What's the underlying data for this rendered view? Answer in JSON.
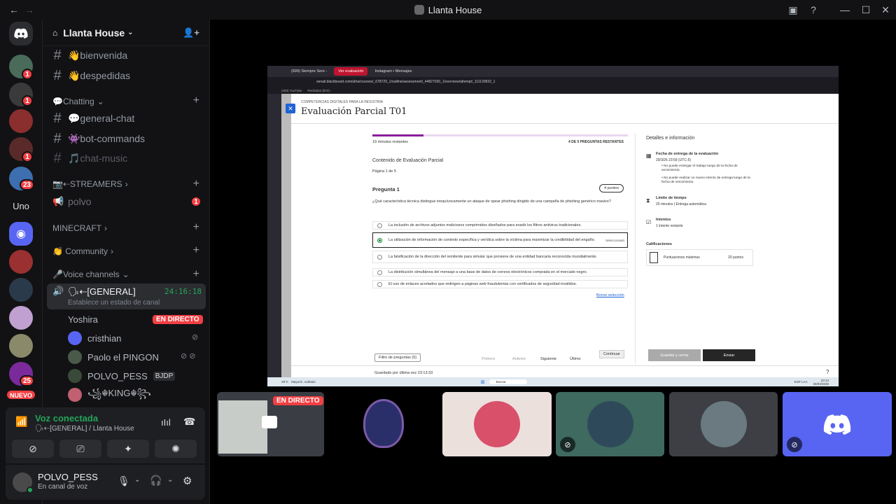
{
  "window": {
    "title": "Llanta House"
  },
  "colors": {
    "accent": "#5865f2",
    "danger": "#f23f43",
    "connected": "#23a55a",
    "bg": "#121214"
  },
  "rail": {
    "badges": [
      "1",
      "1",
      "1",
      "1",
      "23",
      "25"
    ],
    "text_guild": "Uno",
    "new_badge": "NUEVO"
  },
  "server": {
    "name": "Llanta House"
  },
  "channels": {
    "bienvenida": "👋bienvenida",
    "despedidas": "👋despedidas",
    "cat_chatting": "💬Chatting",
    "general_chat": "💬general-chat",
    "bot_commands": "👾bot-commands",
    "chat_music": "🎵chat-music",
    "cat_streamers": "📷⇠STREAMERS",
    "polvo": "polvo",
    "polvo_badge": "1",
    "cat_minecraft": "MINECRAFT",
    "cat_community": "👏 Community",
    "cat_voice": "🎤Voice channels",
    "voice_general": "🗣⇠[GENERAL]",
    "voice_timer": "24:16:18",
    "voice_status": "Establece un estado de canal"
  },
  "voice_users": [
    {
      "name": "Yoshira",
      "live": "EN DIRECTO"
    },
    {
      "name": "cristhian"
    },
    {
      "name": "Paolo el PINGON"
    },
    {
      "name": "POLVO_PESS",
      "tag": "BJDP"
    },
    {
      "name": "꧁☬KING☬꧂"
    }
  ],
  "voicepanel": {
    "status": "Voz conectada",
    "channel": "🗣⇠[GENERAL] / Llanta House"
  },
  "user": {
    "name": "POLVO_PESS",
    "status": "En canal de voz"
  },
  "tiles": {
    "live": "EN DIRECTO"
  },
  "shared": {
    "tabs": [
      "(699) Siempre Sere -",
      "Ver evaluación",
      "Instagram • Mensajes"
    ],
    "url": "senati.blackboard.com/ultra/courses/_678729_1/outline/assessment/_44827030_1/overview/attempt/_111120832_1",
    "bookmarks": [
      "(403) YouTube",
      "Recibidos (872) -"
    ],
    "course": "COMPETENCIAS DIGITALES PARA LA INDUSTRIA",
    "exam_title": "Evaluación Parcial T01",
    "time_left": "19 minutos restantes",
    "progress": "4 DE 5 PREGUNTAS RESTANTES",
    "progress_fraction": 0.2,
    "content_title": "Contenido de Evaluación Parcial",
    "page": "Página 1 de 5",
    "question_title": "Pregunta 1",
    "points": "4 puntos",
    "question": "¿Qué característica técnica distingue inequívocamente un ataque de spear phishing dirigido de una campaña de phishing genérico masivo?",
    "options": [
      "La inclusión de archivos adjuntos maliciosos comprimidos diseñados para evadir los filtros antivirus tradicionales.",
      "La utilización de información de contexto específica y verídica sobre la víctima para maximizar la credibilidad del engaño.",
      "La falsificación de la dirección del remitente para simular que proviene de una entidad bancaria reconocida mundialmente.",
      "La distribución simultánea del mensaje a una base de datos de correos electrónicos comprada en el mercado negro.",
      "El uso de enlaces acortados que redirigen a páginas web fraudulentas con certificados de seguridad inválidos."
    ],
    "selected_label": "Seleccionado",
    "clear": "Borrar selección",
    "continue": "Continuar",
    "saved": "Guardado por última vez 23:13:33",
    "filter": "Filtro de preguntas (5)",
    "nav": [
      "Primero",
      "Anterior",
      "Siguiente",
      "Último"
    ],
    "save_close": "Guardar y cerrar",
    "submit": "Enviar",
    "details_title": "Detalles e información",
    "due_title": "Fecha de entrega de la evaluación",
    "due_date": "29/3/26 23:59 (UTC-5)",
    "due_notes": [
      "No puede entregar el trabajo luego de la fecha de vencimiento.",
      "No puede realizar un nuevo intento de entrega luego de la fecha de vencimiento."
    ],
    "time_limit_title": "Límite de tiempo",
    "time_limit": "20 minutos | Entrega automática",
    "attempts_title": "Intentos",
    "attempts": "1 intento restante",
    "grades_title": "Calificaciones",
    "max_score_label": "Puntuaciones máximas",
    "max_score": "20 puntos",
    "weather": "29°C",
    "weather_sub": "Mayorm. nublado",
    "search": "Buscar",
    "clock": "23:13",
    "date": "26/03/2026",
    "lang": "ESP LAA"
  }
}
